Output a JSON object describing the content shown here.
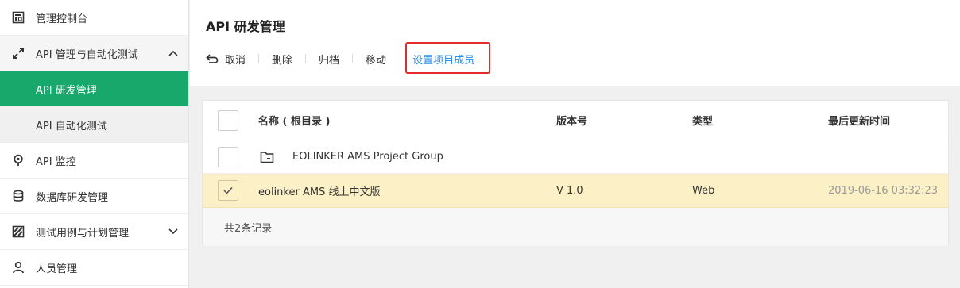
{
  "sidebar": {
    "items": [
      {
        "label": "管理控制台",
        "icon": "dashboard-icon"
      },
      {
        "label": "API 管理与自动化测试",
        "icon": "api-manage-icon"
      },
      {
        "label": "API 研发管理"
      },
      {
        "label": "API 自动化测试"
      },
      {
        "label": "API 监控",
        "icon": "location-pin-icon"
      },
      {
        "label": "数据库研发管理",
        "icon": "database-icon"
      },
      {
        "label": "测试用例与计划管理",
        "icon": "test-case-icon"
      },
      {
        "label": "人员管理",
        "icon": "user-icon"
      }
    ]
  },
  "header": {
    "title": "API 研发管理"
  },
  "toolbar": {
    "cancel": "取消",
    "delete": "删除",
    "archive": "归档",
    "move": "移动",
    "set_members": "设置项目成员"
  },
  "table": {
    "columns": [
      "名称 ( 根目录 )",
      "版本号",
      "类型",
      "最后更新时间"
    ],
    "folder": "EOLINKER AMS Project Group",
    "rows": [
      {
        "name": "eolinker AMS 线上中文版",
        "version": "V 1.0",
        "type": "Web",
        "updated": "2019-06-16 03:32:23",
        "checked": true
      }
    ],
    "footer": "共2条记录"
  },
  "colors": {
    "accent": "#18a86b",
    "link": "#2b8fe6",
    "highlight_border": "#e32b2b",
    "selected_row": "#fcf0c6"
  }
}
